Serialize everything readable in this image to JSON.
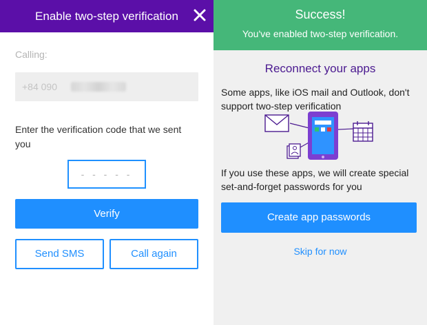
{
  "left_panel": {
    "header": {
      "title": "Enable two-step verification",
      "close_icon": "close-icon"
    },
    "calling_label": "Calling:",
    "phone_number_visible": "+84 090",
    "instructions": "Enter the verification code that we sent you",
    "code_placeholder": "- - - - -",
    "verify_label": "Verify",
    "send_sms_label": "Send SMS",
    "call_again_label": "Call again"
  },
  "right_panel": {
    "success_title": "Success!",
    "success_subtitle": "You've enabled two-step verification.",
    "reconnect_title": "Reconnect your apps",
    "paragraph1": "Some apps, like iOS mail and Outlook, don't support two-step verification",
    "illustration_icons": [
      "mail-icon",
      "phone-icon",
      "calendar-icon",
      "contacts-icon"
    ],
    "paragraph2": "If you use these apps, we will create special set-and-forget passwords for you",
    "create_button_label": "Create app passwords",
    "skip_label": "Skip for now"
  },
  "colors": {
    "header_purple": "#5b0fa8",
    "accent_blue": "#1f8fff",
    "success_green": "#45b779",
    "title_purple": "#4b1a90"
  }
}
